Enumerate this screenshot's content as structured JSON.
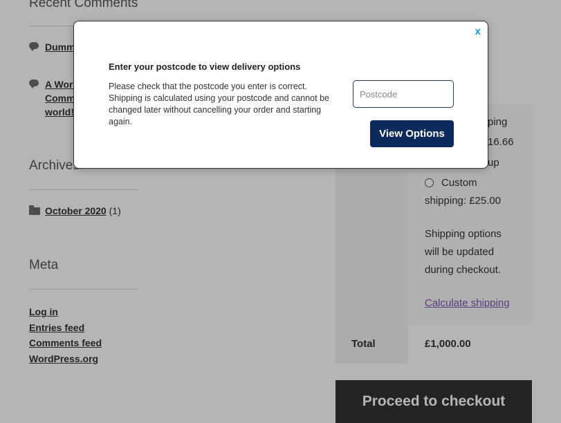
{
  "sidebar": {
    "recent_comments_title": "Recent Comments",
    "comments": [
      {
        "text": "Dummy world!"
      },
      {
        "text": "A WordPress Commenter on Hello world!"
      }
    ],
    "archives_title": "Archives",
    "archive_item": {
      "label": "October 2020",
      "count": "(1)"
    },
    "meta_title": "Meta",
    "meta_links": [
      "Log in",
      "Entries feed",
      "Comments feed",
      "WordPress.org"
    ]
  },
  "cart": {
    "shipping_partial_1": "ping",
    "shipping_partial_2": "16.66",
    "shipping_partial_3": "up",
    "custom_shipping": "Custom",
    "custom_shipping_price": "shipping: £25.00",
    "update_note": [
      "Shipping options",
      "will be updated",
      "during checkout."
    ],
    "calc_link": "Calculate shipping",
    "total_label": "Total",
    "total_value": "£1,000.00",
    "checkout_button": "Proceed to checkout"
  },
  "modal": {
    "close": "x",
    "title": "Enter your postcode to view delivery options",
    "description": "Please check that the postcode you enter is correct. Shipping is calculated using your postcode and cannot be changed later without cancelling your order and starting again.",
    "postcode_placeholder": "Postcode",
    "view_button": "View Options"
  },
  "colors": {
    "accent_close": "#1a9fd8",
    "button_navy": "#0d2a5c",
    "link_purple": "#7f54b3"
  }
}
